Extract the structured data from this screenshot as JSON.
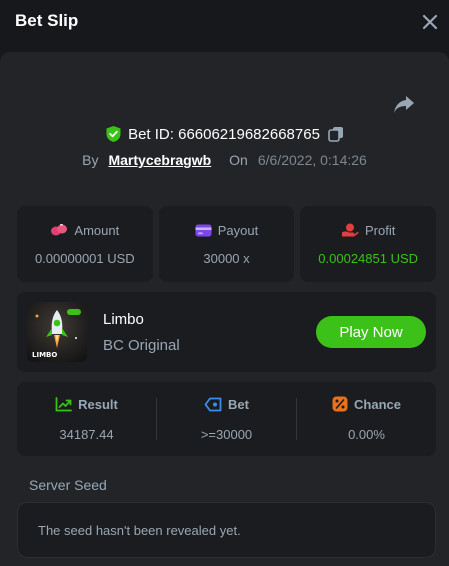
{
  "header": {
    "title": "Bet Slip"
  },
  "bet": {
    "id_text": "Bet ID: 666062196826687​65",
    "by_label": "By",
    "user": "Martycebragwb",
    "on_label": "On",
    "date": "6/6/2022, 0:14:26"
  },
  "stats": [
    {
      "label": "Amount",
      "value": "0.00000001 USD",
      "icon": "coins-icon"
    },
    {
      "label": "Payout",
      "value": "30000 x",
      "icon": "card-icon"
    },
    {
      "label": "Profit",
      "value": "0.00024851 USD",
      "icon": "hand-coin-icon"
    }
  ],
  "game": {
    "name": "Limbo",
    "subtitle": "BC Original",
    "thumb_text": "LIMBO",
    "play_label": "Play Now"
  },
  "details": [
    {
      "label": "Result",
      "value": "34187.44",
      "icon": "chart-up-icon"
    },
    {
      "label": "Bet",
      "value": ">=30000",
      "icon": "ticket-icon"
    },
    {
      "label": "Chance",
      "value": "0.00%",
      "icon": "percent-icon"
    }
  ],
  "seed": {
    "title": "Server Seed",
    "message": "The seed hasn't been revealed yet."
  },
  "colors": {
    "accent_green": "#3bc117",
    "background": "#17181b",
    "panel": "#232427",
    "card": "#1b1c1f"
  }
}
